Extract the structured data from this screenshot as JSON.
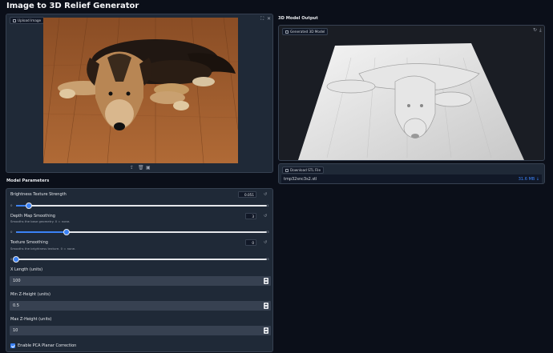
{
  "app": {
    "title": "Image to 3D Relief Generator"
  },
  "upload": {
    "label": "Upload Image",
    "icons": [
      "upload-icon",
      "trash-icon",
      "clipboard-icon",
      "fullscreen-icon",
      "close-icon"
    ]
  },
  "output": {
    "heading": "3D Model Output",
    "model_label": "Generated 3D Model",
    "download_label": "Download STL File",
    "file_name": "tmp32snc3s2.stl",
    "file_size": "31.6 MB ↓"
  },
  "params": {
    "heading": "Model Parameters",
    "brightness": {
      "label": "Brightness Texture Strength",
      "value": "0.051",
      "min": "0",
      "max": "1",
      "fraction": 0.051
    },
    "depth": {
      "label": "Depth Map Smoothing",
      "sub": "Smooths the base geometry. 0 = none.",
      "value": "3",
      "min": "0",
      "max": "15",
      "fraction": 0.2
    },
    "texture": {
      "label": "Texture Smoothing",
      "sub": "Smooths the brightness texture. 0 = none.",
      "value": "0",
      "min": "0",
      "max": "15",
      "fraction": 0.0
    },
    "x_length": {
      "label": "X Length (units)",
      "value": "100"
    },
    "min_z": {
      "label": "Min Z-Height (units)",
      "value": "0.5"
    },
    "max_z": {
      "label": "Max Z-Height (units)",
      "value": "10"
    },
    "pca": {
      "label": "Enable PCA Planar Correction",
      "checked": true
    }
  },
  "colors": {
    "accent": "#3b82f6",
    "background": "#0b0f19",
    "panel": "#1f2937"
  }
}
